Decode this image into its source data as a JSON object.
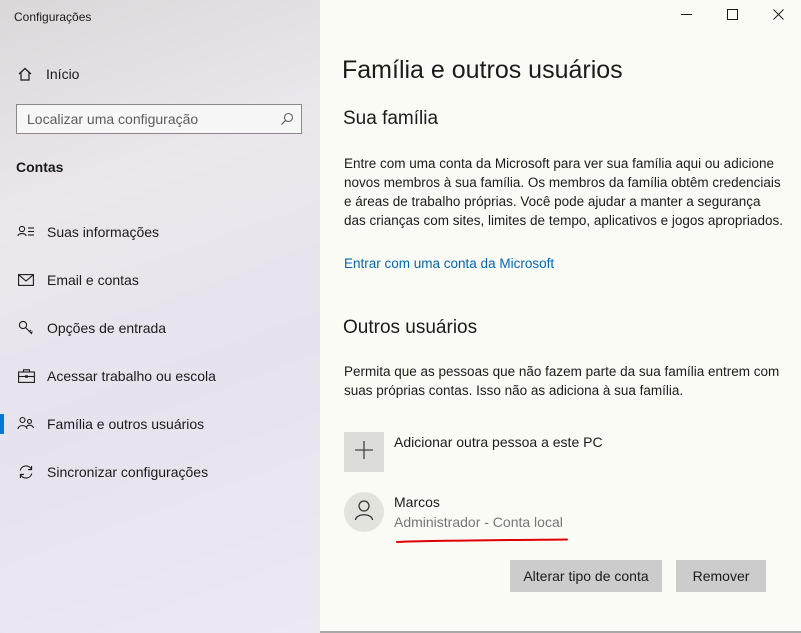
{
  "window": {
    "app_title": "Configurações",
    "controls": [
      {
        "name": "minimize-button",
        "icon": "minimize-icon"
      },
      {
        "name": "maximize-button",
        "icon": "maximize-icon"
      },
      {
        "name": "close-button",
        "icon": "close-icon"
      }
    ]
  },
  "sidebar": {
    "home": {
      "label": "Início",
      "icon": "home-icon"
    },
    "search": {
      "placeholder": "Localizar uma configuração",
      "icon": "search-icon"
    },
    "section_title": "Contas",
    "items": [
      {
        "label": "Suas informações",
        "icon": "person-card-icon",
        "active": false
      },
      {
        "label": "Email e contas",
        "icon": "mail-icon",
        "active": false
      },
      {
        "label": "Opções de entrada",
        "icon": "key-icon",
        "active": false
      },
      {
        "label": "Acessar trabalho ou escola",
        "icon": "briefcase-icon",
        "active": false
      },
      {
        "label": "Família e outros usuários",
        "icon": "family-icon",
        "active": true
      },
      {
        "label": "Sincronizar configurações",
        "icon": "sync-icon",
        "active": false
      }
    ]
  },
  "main": {
    "title": "Família e outros usuários",
    "family": {
      "heading": "Sua família",
      "description": "Entre com uma conta da Microsoft para ver sua família aqui ou adicione novos membros à sua família. Os membros da família obtêm credenciais e áreas de trabalho próprias. Você pode ajudar a manter a segurança das crianças com sites, limites de tempo, aplicativos e jogos apropriados.",
      "link": "Entrar com uma conta da Microsoft"
    },
    "others": {
      "heading": "Outros usuários",
      "description": "Permita que as pessoas que não fazem parte da sua família entrem com suas próprias contas. Isso não as adiciona à sua família.",
      "add_label": "Adicionar outra pessoa a este PC",
      "user": {
        "name": "Marcos",
        "role": "Administrador - Conta local"
      },
      "buttons": {
        "change": "Alterar tipo de conta",
        "remove": "Remover"
      }
    },
    "colors": {
      "accent": "#0078d7",
      "link": "#0067b8",
      "annotation": "#e00000"
    }
  }
}
